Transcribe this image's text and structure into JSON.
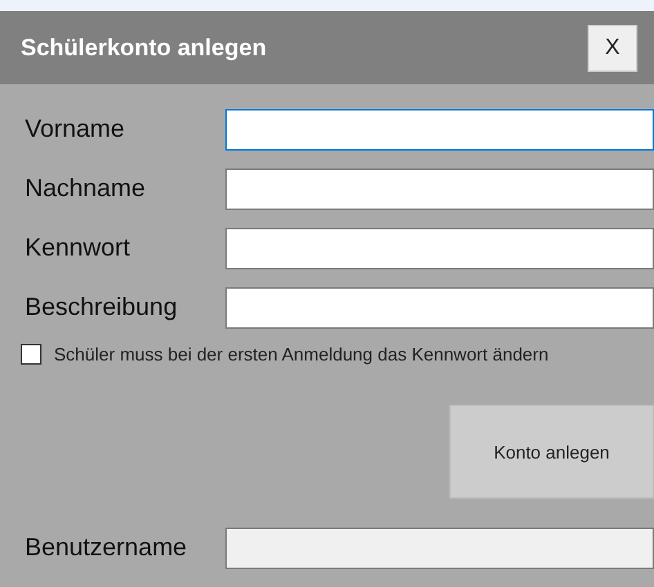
{
  "window": {
    "title": "Schülerkonto anlegen",
    "close": "X"
  },
  "fields": [
    {
      "label": "Vorname",
      "focused": true,
      "disabled": false
    },
    {
      "label": "Nachname",
      "focused": false,
      "disabled": false
    },
    {
      "label": "Kennwort",
      "focused": false,
      "disabled": false
    },
    {
      "label": "Beschreibung",
      "focused": false,
      "disabled": false
    }
  ],
  "checkbox": {
    "label": "Schüler muss bei der ersten Anmeldung das Kennwort ändern",
    "checked": false
  },
  "button": "Konto anlegen",
  "username": {
    "label": "Benutzername",
    "focused": false,
    "disabled": true
  }
}
